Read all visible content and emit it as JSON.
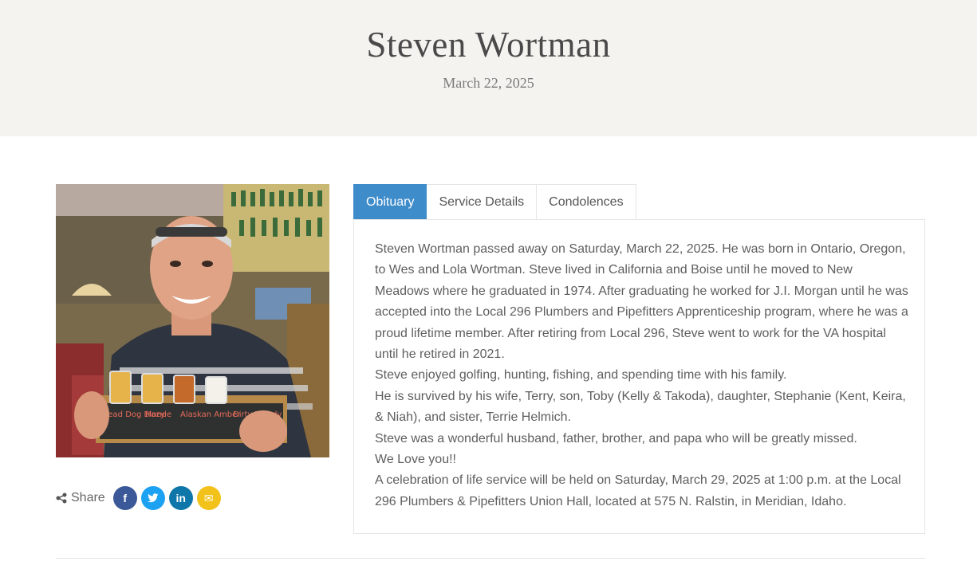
{
  "header": {
    "name": "Steven Wortman",
    "date": "March 22, 2025"
  },
  "photo": {
    "tray_labels": [
      "Lead Dog Blonde",
      "Hazy",
      "Alaskan Amber",
      "Dirty Woody"
    ]
  },
  "share": {
    "label": "Share",
    "buttons": [
      {
        "icon": "facebook-icon",
        "glyph": "f",
        "color": "#3b5998"
      },
      {
        "icon": "twitter-icon",
        "glyph": "t",
        "color": "#1da1f2"
      },
      {
        "icon": "linkedin-icon",
        "glyph": "in",
        "color": "#0e76a8"
      },
      {
        "icon": "email-icon",
        "glyph": "✉",
        "color": "#f2c21b"
      }
    ]
  },
  "tabs": [
    {
      "label": "Obituary",
      "active": true
    },
    {
      "label": "Service Details",
      "active": false
    },
    {
      "label": "Condolences",
      "active": false
    }
  ],
  "obituary": {
    "paragraphs": [
      "Steven Wortman passed away on Saturday, March 22, 2025. He was born in Ontario, Oregon, to Wes and Lola Wortman.  Steve lived in California and Boise until he moved to New Meadows where he graduated in 1974.  After graduating he worked for J.I. Morgan until he was accepted into the Local 296 Plumbers and Pipefitters Apprenticeship program, where he was a proud lifetime member. After retiring from Local 296, Steve went to work for the VA hospital until he retired in 2021.",
      "Steve enjoyed golfing, hunting, fishing, and spending time with his family.",
      "He is survived by his wife, Terry, son, Toby (Kelly & Takoda), daughter, Stephanie (Kent, Keira, & Niah), and sister, Terrie Helmich.",
      "Steve was a wonderful husband, father, brother, and papa who will be greatly missed.",
      "We Love you!!",
      "A celebration of life service will be held on Saturday, March 29, 2025 at 1:00 p.m. at the Local 296 Plumbers & Pipefitters Union Hall, located at 575 N. Ralstin, in Meridian, Idaho."
    ]
  },
  "colors": {
    "accent": "#3f8ccb",
    "hero_bg": "#f5f3ef"
  }
}
